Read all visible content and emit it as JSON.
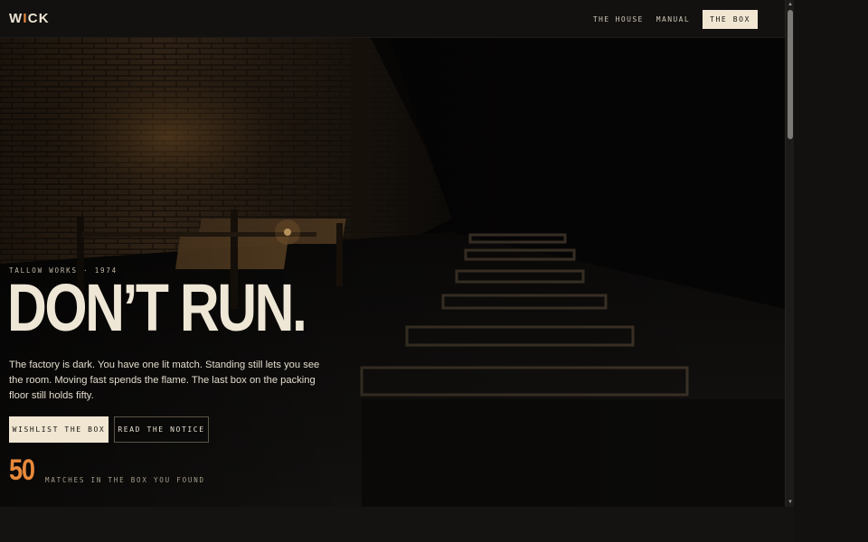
{
  "brand": {
    "logo_first": "W",
    "logo_accent": "I",
    "logo_rest": "CK",
    "accent_color": "#e88a3b"
  },
  "nav": {
    "items": [
      "THE HOUSE",
      "MANUAL"
    ],
    "cta": "THE BOX"
  },
  "hero": {
    "eyebrow": "TALLOW WORKS · 1974",
    "headline": "DON’T RUN.",
    "body": "The factory is dark. You have one lit match. Standing still lets you see the room. Moving fast spends the flame. The last box on the packing floor still holds fifty.",
    "primary_button": "WISHLIST THE BOX",
    "secondary_button": "READ THE NOTICE",
    "stat_value": "50",
    "stat_label": "MATCHES IN THE BOX YOU FOUND"
  },
  "icons": {
    "scroll_up": "triangle-up-icon",
    "scroll_down": "triangle-down-icon"
  }
}
